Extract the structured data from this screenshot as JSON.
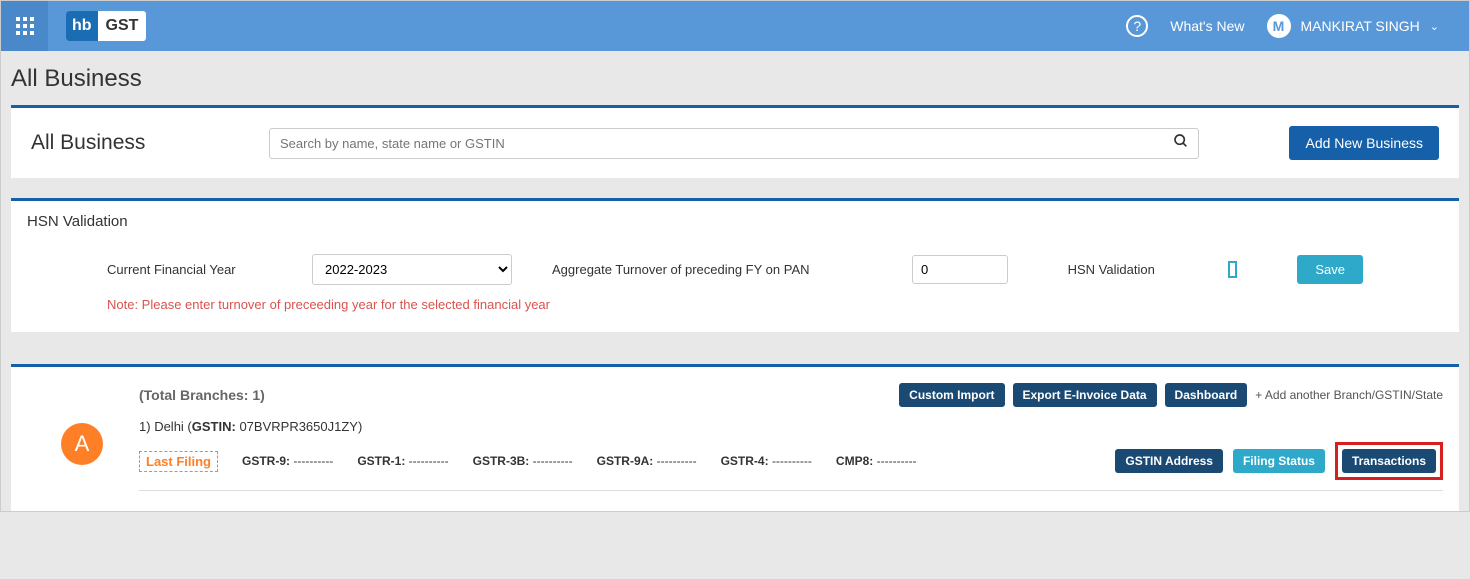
{
  "header": {
    "logo_hb": "hb",
    "logo_gst": "GST",
    "help": "?",
    "whats_new": "What's New",
    "user_initial": "M",
    "username": "MANKIRAT SINGH"
  },
  "page_title": "All Business",
  "search_card": {
    "title": "All Business",
    "placeholder": "Search by name, state name or GSTIN",
    "add_button": "Add New Business"
  },
  "hsn": {
    "title": "HSN Validation",
    "fy_label": "Current Financial Year",
    "fy_value": "2022-2023",
    "turnover_label": "Aggregate Turnover of preceding FY on PAN",
    "turnover_value": "0",
    "validation_label": "HSN Validation",
    "save": "Save",
    "note": "Note: Please enter turnover of preceeding year for the selected financial year"
  },
  "business": {
    "total_label": "(Total Branches: 1)",
    "actions": {
      "custom_import": "Custom Import",
      "export_einvoice": "Export E-Invoice Data",
      "dashboard": "Dashboard",
      "add_branch": "+ Add another Branch/GSTIN/State"
    },
    "avatar": "A",
    "branch": {
      "index": "1)",
      "state": "Delhi",
      "gstin_label": "GSTIN:",
      "gstin_value": "07BVRPR3650J1ZY"
    },
    "last_filing": "Last Filing",
    "gstr": {
      "gstr9": "GSTR-9:",
      "gstr1": "GSTR-1:",
      "gstr3b": "GSTR-3B:",
      "gstr9a": "GSTR-9A:",
      "gstr4": "GSTR-4:",
      "cmp8": "CMP8:",
      "dash": "----------"
    },
    "branch_actions": {
      "gstin_address": "GSTIN Address",
      "filing_status": "Filing Status",
      "transactions": "Transactions"
    }
  }
}
